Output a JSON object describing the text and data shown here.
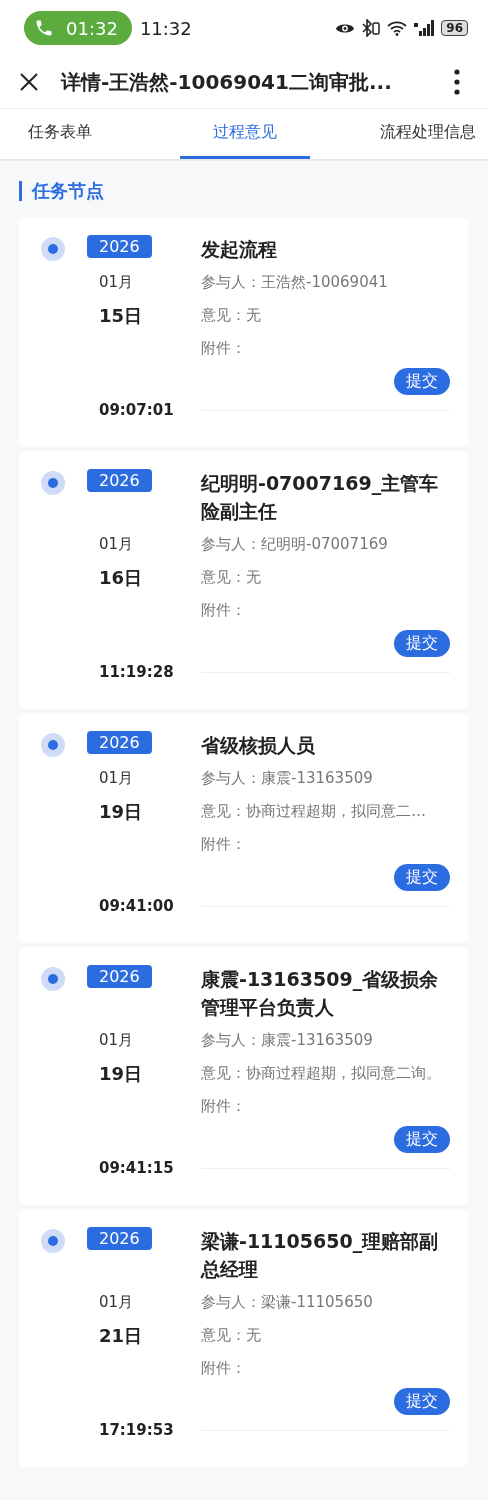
{
  "status_bar": {
    "call_time": "01:32",
    "time": "11:32",
    "battery": "96"
  },
  "header": {
    "title": "详情-王浩然-10069041二询审批..."
  },
  "tabs": [
    {
      "label": "任务表单",
      "selected": false
    },
    {
      "label": "过程意见",
      "selected": true
    },
    {
      "label": "流程处理信息",
      "selected": false
    }
  ],
  "section_title": "任务节点",
  "nodes": [
    {
      "year": "2026",
      "month": "01月",
      "day": "15日",
      "time": "09:07:01",
      "title": "发起流程",
      "participant": "参与人：王浩然-10069041",
      "opinion": "意见：无",
      "attachment": "附件：",
      "action": "提交"
    },
    {
      "year": "2026",
      "month": "01月",
      "day": "16日",
      "time": "11:19:28",
      "title": "纪明明-07007169_主管车险副主任",
      "participant": "参与人：纪明明-07007169",
      "opinion": "意见：无",
      "attachment": "附件：",
      "action": "提交"
    },
    {
      "year": "2026",
      "month": "01月",
      "day": "19日",
      "time": "09:41:00",
      "title": "省级核损人员",
      "participant": "参与人：康震-13163509",
      "opinion": "意见：协商过程超期，拟同意二…",
      "attachment": "附件：",
      "action": "提交"
    },
    {
      "year": "2026",
      "month": "01月",
      "day": "19日",
      "time": "09:41:15",
      "title": "康震-13163509_省级损余管理平台负责人",
      "participant": "参与人：康震-13163509",
      "opinion": "意见：协商过程超期，拟同意二询。",
      "attachment": "附件：",
      "action": "提交"
    },
    {
      "year": "2026",
      "month": "01月",
      "day": "21日",
      "time": "17:19:53",
      "title": "梁谦-11105650_理赔部副总经理",
      "participant": "参与人：梁谦-11105650",
      "opinion": "意见：无",
      "attachment": "附件：",
      "action": "提交"
    }
  ]
}
